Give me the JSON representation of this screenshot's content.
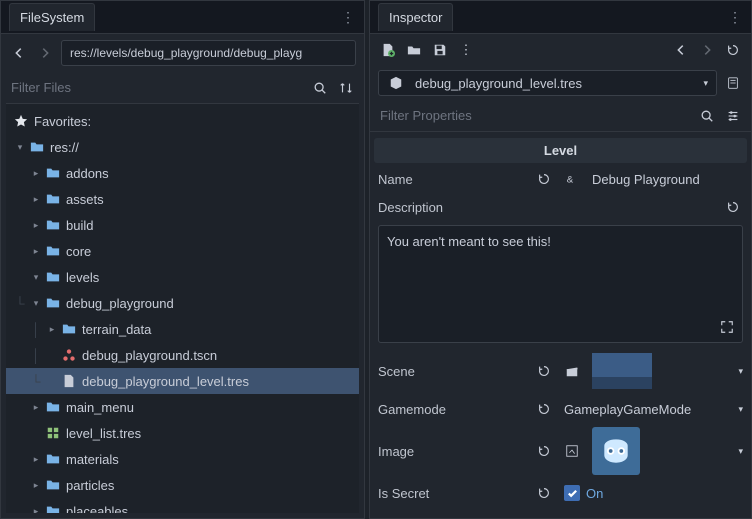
{
  "filesystem": {
    "tab": "FileSystem",
    "path": "res://levels/debug_playground/debug_playg",
    "filter_placeholder": "Filter Files",
    "favorites": "Favorites:",
    "root": "res://",
    "folders": {
      "addons": "addons",
      "assets": "assets",
      "build": "build",
      "core": "core",
      "levels": "levels",
      "debug_playground": "debug_playground",
      "terrain_data": "terrain_data",
      "main_menu": "main_menu",
      "materials": "materials",
      "particles": "particles",
      "placeables": "placeables"
    },
    "files": {
      "tscn": "debug_playground.tscn",
      "tres_level": "debug_playground_level.tres",
      "level_list": "level_list.tres"
    }
  },
  "inspector": {
    "tab": "Inspector",
    "resource": "debug_playground_level.tres",
    "filter_placeholder": "Filter Properties",
    "section": "Level",
    "name_label": "Name",
    "name_value": "Debug Playground",
    "description_label": "Description",
    "description_value": "You aren't meant to see this!",
    "scene_label": "Scene",
    "gamemode_label": "Gamemode",
    "gamemode_value": "GameplayGameMode",
    "image_label": "Image",
    "is_secret_label": "Is Secret",
    "is_secret_value": "On"
  }
}
